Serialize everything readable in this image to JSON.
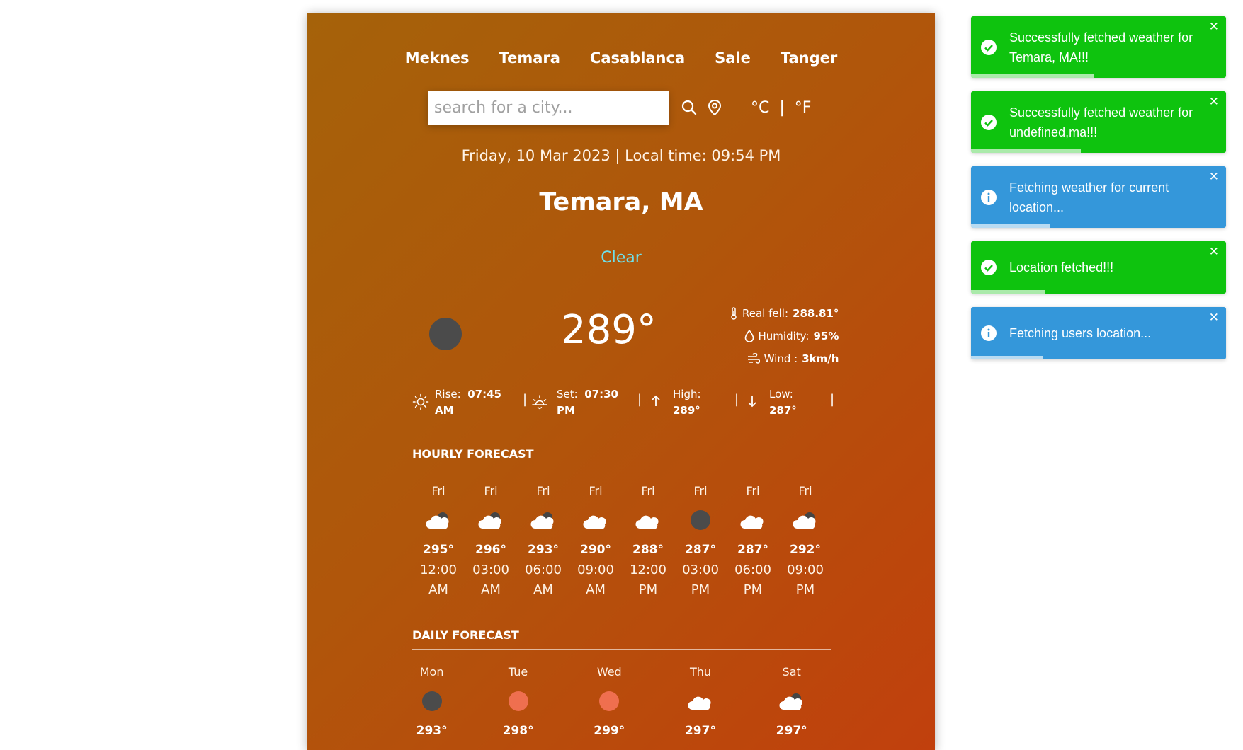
{
  "cities": [
    "Meknes",
    "Temara",
    "Casablanca",
    "Sale",
    "Tanger"
  ],
  "search": {
    "placeholder": "search for a city..."
  },
  "units": {
    "celsius": "°C",
    "separator": "|",
    "fahrenheit": "°F"
  },
  "datetime": "Friday, 10 Mar 2023 | Local time: 09:54 PM",
  "location": "Temara, MA",
  "condition": "Clear",
  "current": {
    "icon": "dark-circle-icon",
    "temperature": "289°",
    "real_feel_label": "Real fell:",
    "real_feel_value": "288.81°",
    "humidity_label": "Humidity:",
    "humidity_value": "95%",
    "wind_label": "Wind :",
    "wind_value": "3km/h"
  },
  "stats": {
    "rise_label": "Rise:",
    "rise_value_1": "07:45",
    "rise_value_2": "AM",
    "set_label": "Set:",
    "set_value_1": "07:30",
    "set_value_2": "PM",
    "high_label": "High:",
    "high_value": "289°",
    "low_label": "Low:",
    "low_value": "287°",
    "separator": "|"
  },
  "hourly_title": "HOURLY FORECAST",
  "hourly": [
    {
      "day": "Fri",
      "icon": "cloud-night-icon",
      "temp": "295°",
      "time1": "12:00",
      "time2": "AM"
    },
    {
      "day": "Fri",
      "icon": "cloud-night-icon",
      "temp": "296°",
      "time1": "03:00",
      "time2": "AM"
    },
    {
      "day": "Fri",
      "icon": "cloud-night-icon",
      "temp": "293°",
      "time1": "06:00",
      "time2": "AM"
    },
    {
      "day": "Fri",
      "icon": "cloud-icon",
      "temp": "290°",
      "time1": "09:00",
      "time2": "AM"
    },
    {
      "day": "Fri",
      "icon": "cloud-icon",
      "temp": "288°",
      "time1": "12:00",
      "time2": "PM"
    },
    {
      "day": "Fri",
      "icon": "dark-circle-icon",
      "temp": "287°",
      "time1": "03:00",
      "time2": "PM"
    },
    {
      "day": "Fri",
      "icon": "cloud-icon",
      "temp": "287°",
      "time1": "06:00",
      "time2": "PM"
    },
    {
      "day": "Fri",
      "icon": "cloud-night-icon",
      "temp": "292°",
      "time1": "09:00",
      "time2": "PM"
    }
  ],
  "daily_title": "DAILY FORECAST",
  "daily": [
    {
      "day": "Mon",
      "icon": "dark-circle-icon",
      "temp": "293°"
    },
    {
      "day": "Tue",
      "icon": "sun-circle-icon",
      "temp": "298°"
    },
    {
      "day": "Wed",
      "icon": "sun-circle-icon",
      "temp": "299°"
    },
    {
      "day": "Thu",
      "icon": "cloud-icon",
      "temp": "297°"
    },
    {
      "day": "Sat",
      "icon": "cloud-night-icon",
      "temp": "297°"
    }
  ],
  "toasts": [
    {
      "type": "success",
      "message": "Successfully fetched weather for Temara, MA!!!",
      "progress": 0.48
    },
    {
      "type": "success",
      "message": "Successfully fetched weather for undefined,ma!!!",
      "progress": 0.43
    },
    {
      "type": "info",
      "message": "Fetching weather for current location...",
      "progress": 0.31
    },
    {
      "type": "success",
      "message": "Location fetched!!!",
      "progress": 0.29
    },
    {
      "type": "info",
      "message": "Fetching users location...",
      "progress": 0.28
    }
  ],
  "colors": {
    "accent_condition": "#6fe0ea",
    "toast_success": "#0ec30e",
    "toast_info": "#3497da",
    "dark_circle": "#4b4b4b",
    "sun_circle": "#ef6f4f"
  }
}
